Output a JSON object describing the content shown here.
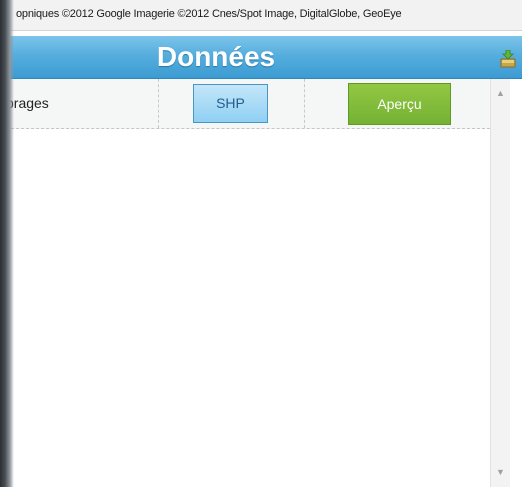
{
  "attribution": {
    "text": "opniques ©2012 Google Imagerie ©2012 Cnes/Spot Image, DigitalGlobe, GeoEye"
  },
  "panel": {
    "title": "Données",
    "row": {
      "label": "brages",
      "shp_label": "SHP",
      "apercu_label": "Aperçu"
    }
  },
  "colors": {
    "header_blue": "#4aa8dc",
    "shp_blue": "#a8dbf5",
    "apercu_green": "#7cb83a"
  },
  "icons": {
    "download": "download-icon",
    "scroll_up": "triangle-up-icon",
    "scroll_down": "triangle-down-icon"
  }
}
